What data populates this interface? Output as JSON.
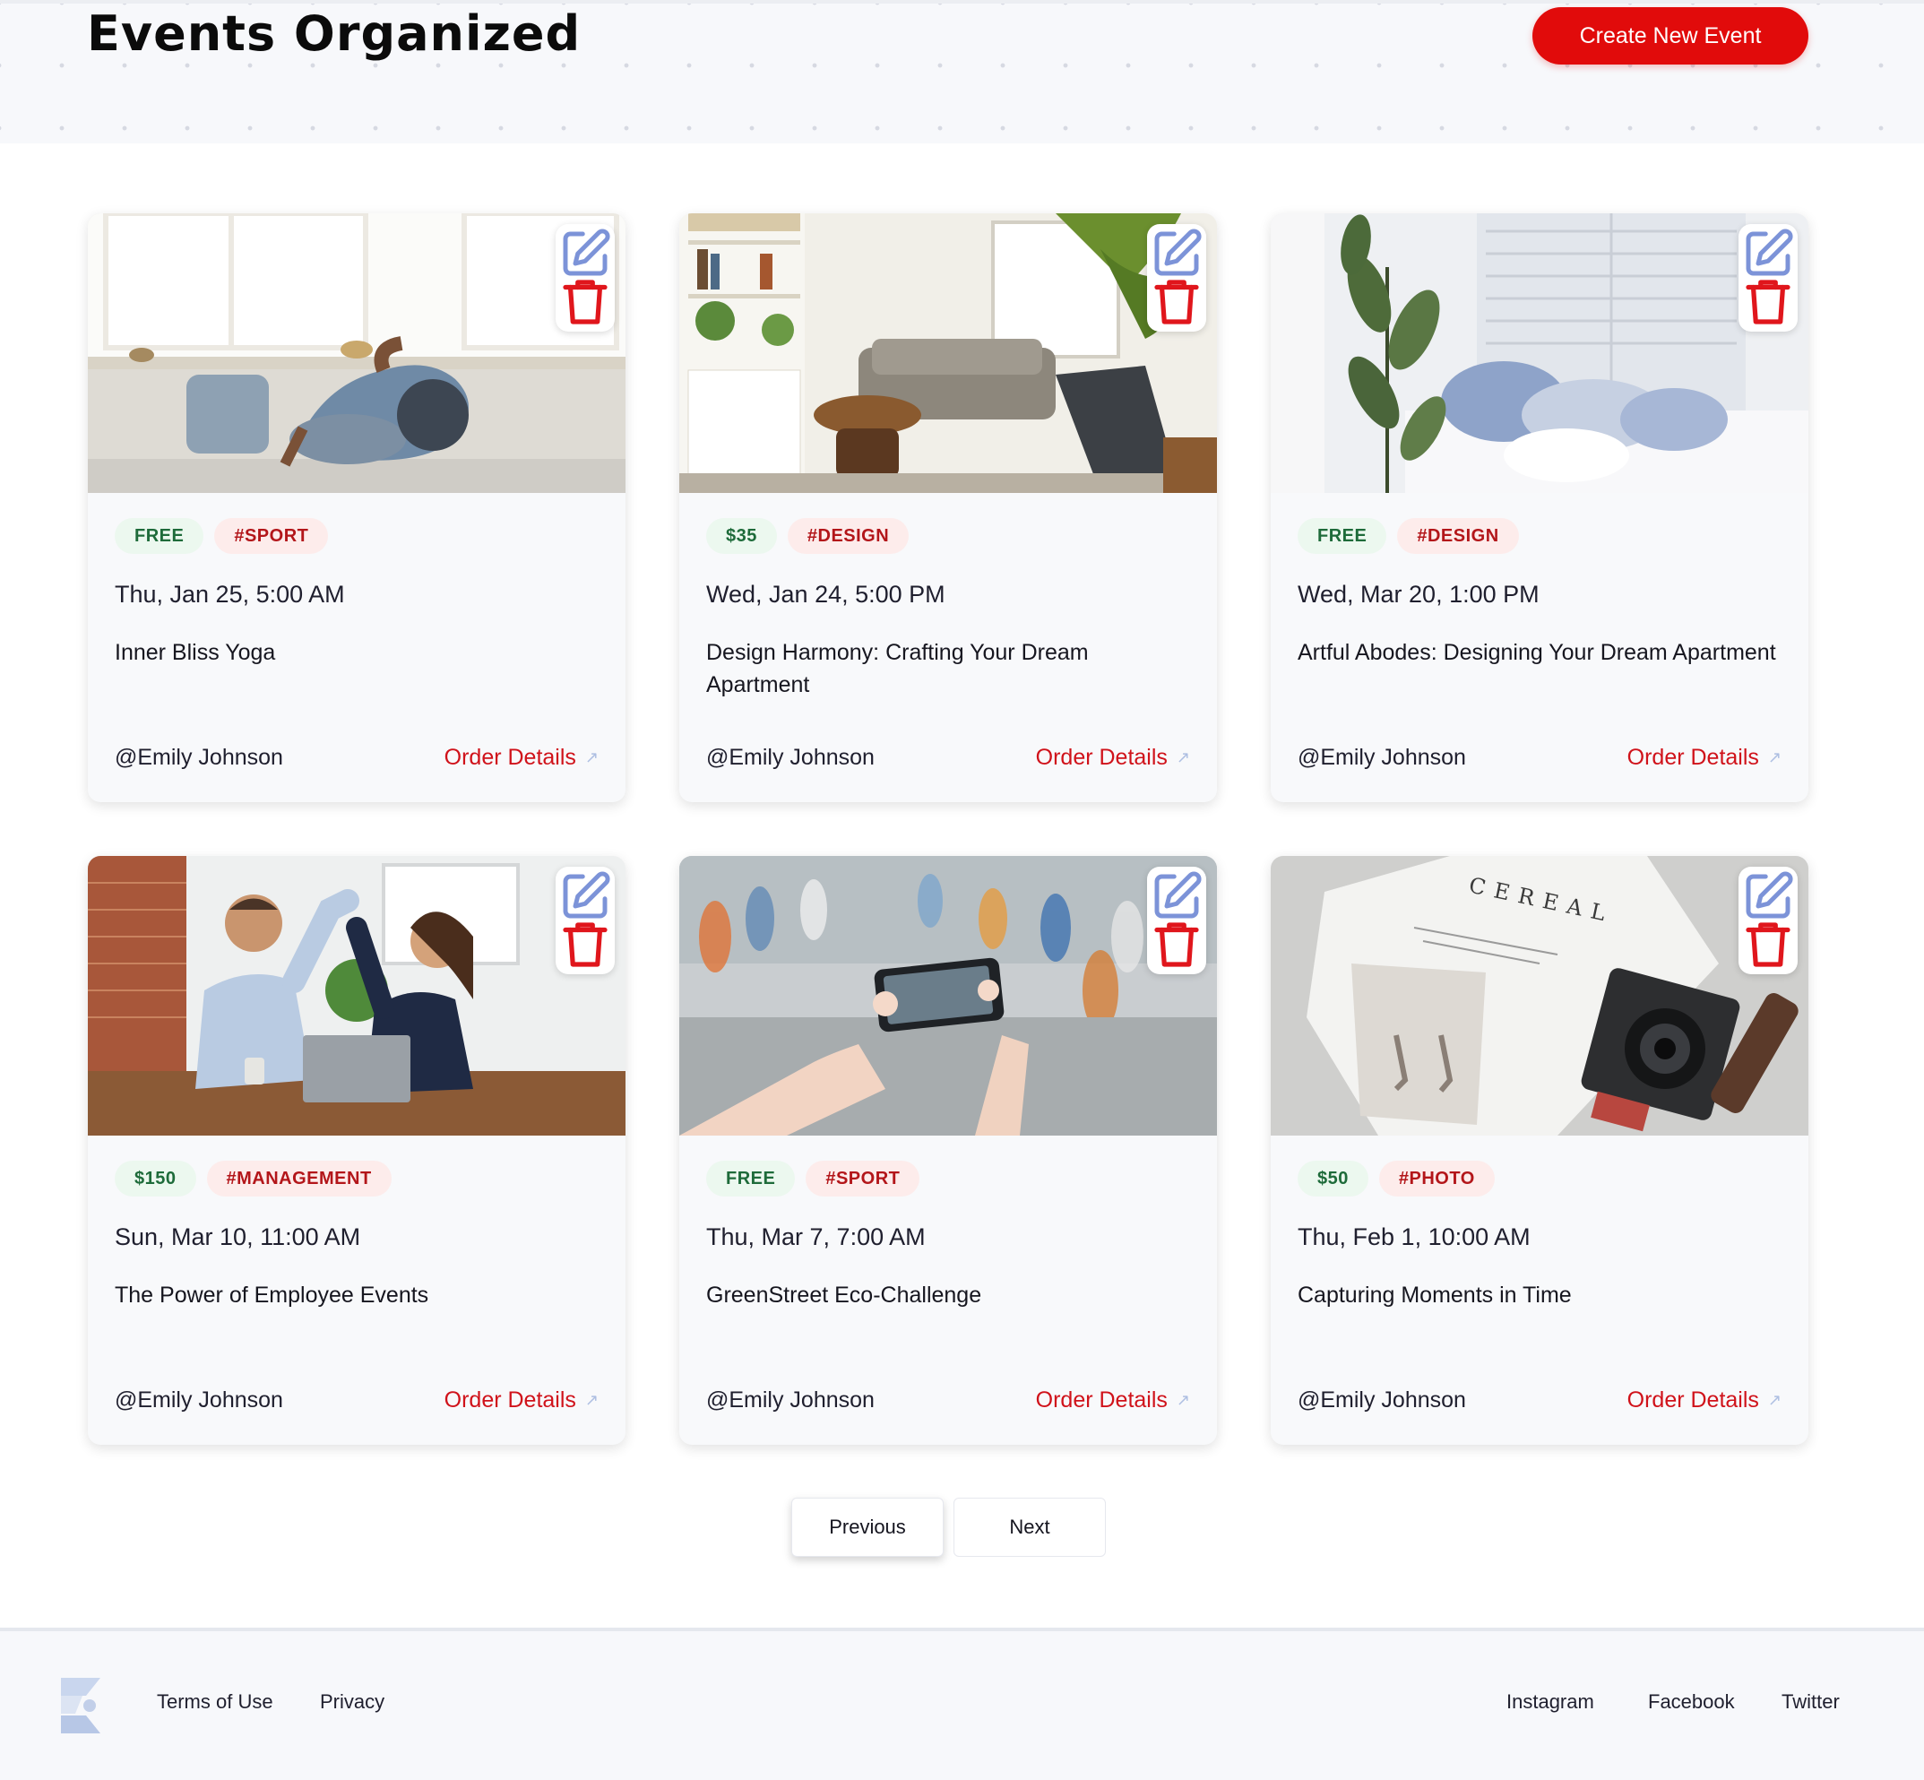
{
  "header": {
    "title": "Events Organized",
    "create_button": "Create New Event"
  },
  "events": [
    {
      "price": "FREE",
      "category": "#SPORT",
      "date": "Thu, Jan 25, 5:00 AM",
      "title": "Inner Bliss Yoga",
      "author": "@Emily Johnson",
      "link": "Order Details"
    },
    {
      "price": "$35",
      "category": "#DESIGN",
      "date": "Wed, Jan 24, 5:00 PM",
      "title": "Design Harmony: Crafting Your Dream Apartment",
      "author": "@Emily Johnson",
      "link": "Order Details"
    },
    {
      "price": "FREE",
      "category": "#DESIGN",
      "date": "Wed, Mar 20, 1:00 PM",
      "title": "Artful Abodes: Designing Your Dream Apartment",
      "author": "@Emily Johnson",
      "link": "Order Details"
    },
    {
      "price": "$150",
      "category": "#MANAGEMENT",
      "date": "Sun, Mar 10, 11:00 AM",
      "title": "The Power of Employee Events",
      "author": "@Emily Johnson",
      "link": "Order Details"
    },
    {
      "price": "FREE",
      "category": "#SPORT",
      "date": "Thu, Mar 7, 7:00 AM",
      "title": "GreenStreet Eco-Challenge",
      "author": "@Emily Johnson",
      "link": "Order Details"
    },
    {
      "price": "$50",
      "category": "#PHOTO",
      "date": "Thu, Feb 1, 10:00 AM",
      "title": "Capturing Moments in Time",
      "author": "@Emily Johnson",
      "link": "Order Details"
    }
  ],
  "image_text": {
    "magazine": "CEREAL"
  },
  "pagination": {
    "previous": "Previous",
    "next": "Next"
  },
  "footer": {
    "links_left": [
      "Terms of Use",
      "Privacy"
    ],
    "links_right": [
      "Instagram",
      "Facebook",
      "Twitter"
    ]
  },
  "icons": {
    "edit": "edit-icon",
    "delete": "trash-icon",
    "arrow": "arrow-up-right-icon",
    "logo": "logo-icon"
  },
  "colors": {
    "accent": "#e10b0b",
    "price_tag_bg": "#ecf8ef",
    "price_tag_text": "#1e6b3a",
    "category_tag_bg": "#fdeceb",
    "category_tag_text": "#b3161a",
    "link": "#d0121a"
  }
}
